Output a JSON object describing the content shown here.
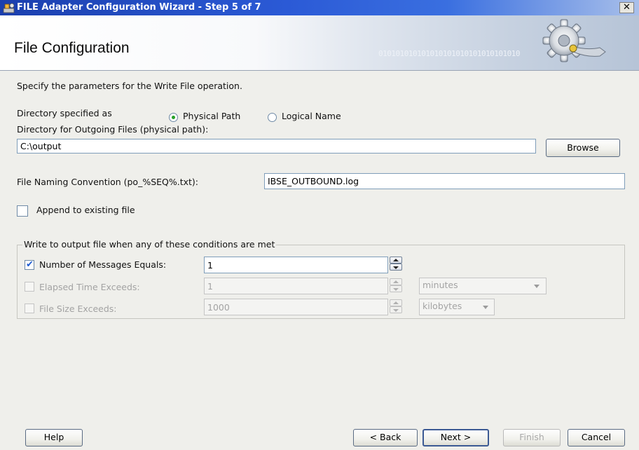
{
  "window": {
    "title": "FILE Adapter Configuration Wizard - Step 5 of 7",
    "close_label": "✕"
  },
  "header": {
    "title": "File Configuration",
    "decoration": "010101010101010101010101010101010"
  },
  "main": {
    "instruction": "Specify the parameters for the Write File operation.",
    "directory_specified_label": "Directory specified as",
    "radio_physical_label": "Physical Path",
    "radio_logical_label": "Logical Name",
    "selected_directory_mode": "Physical Path",
    "directory_field_label": "Directory for Outgoing Files (physical path):",
    "directory_value": "C:\\output",
    "browse_label": "Browse",
    "naming_label": "File Naming Convention (po_%SEQ%.txt):",
    "naming_value": "IBSE_OUTBOUND.log",
    "append_label": "Append to existing file",
    "append_checked": false
  },
  "conditions": {
    "legend": "Write to output file when any of these conditions are met",
    "messages_label": "Number of Messages Equals:",
    "messages_checked": true,
    "messages_value": "1",
    "elapsed_label": "Elapsed Time Exceeds:",
    "elapsed_checked": false,
    "elapsed_value": "1",
    "elapsed_unit": "minutes",
    "size_label": "File Size Exceeds:",
    "size_checked": false,
    "size_value": "1000",
    "size_unit": "kilobytes"
  },
  "footer": {
    "help_label": "Help",
    "back_label": "< Back",
    "next_label": "Next >",
    "finish_label": "Finish",
    "cancel_label": "Cancel"
  },
  "colors": {
    "titlebar": "#2b5ad6",
    "radio_selected": "#25a028",
    "checkmark": "#1d5bd1"
  }
}
